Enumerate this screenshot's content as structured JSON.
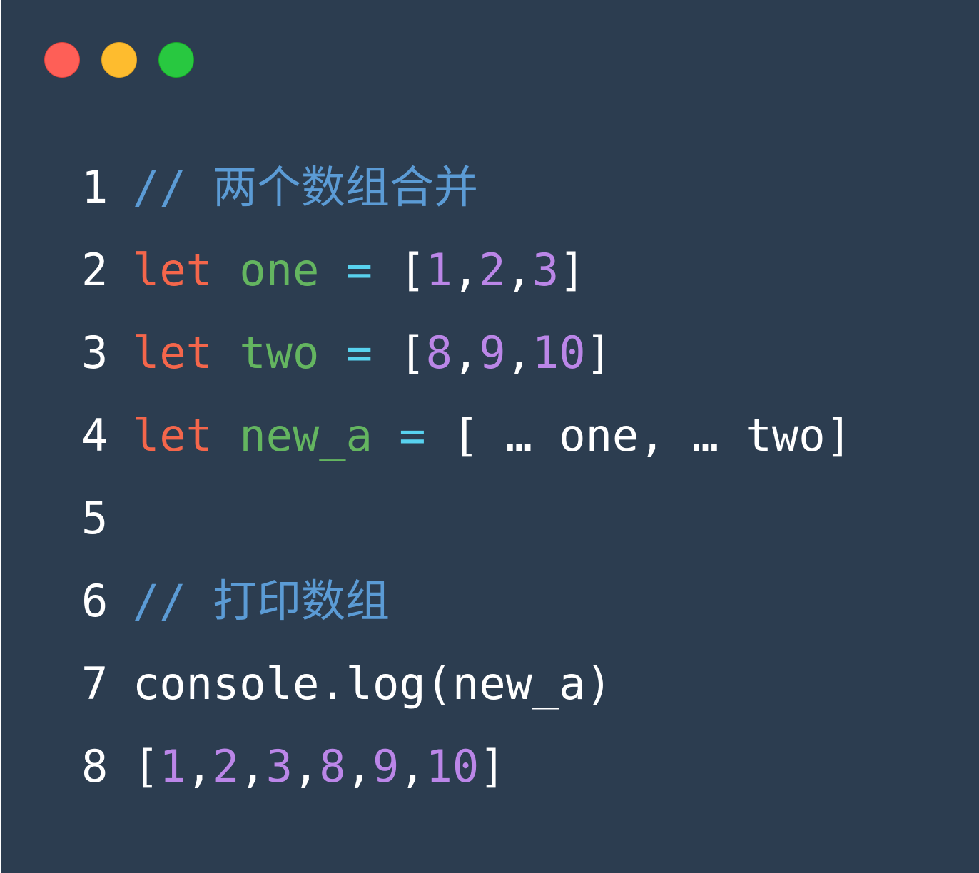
{
  "window": {
    "controls": [
      "close",
      "minimize",
      "maximize"
    ]
  },
  "colors": {
    "background": "#2c3d50",
    "keyword": "#f4664b",
    "identifier": "#64b560",
    "operator": "#58d2ef",
    "number": "#bb86e8",
    "comment": "#5b9bd5",
    "text": "#ffffff"
  },
  "code": {
    "lines": [
      {
        "num": "1",
        "tokens": [
          {
            "t": "// 两个数组合并",
            "c": "cm"
          }
        ]
      },
      {
        "num": "2",
        "tokens": [
          {
            "t": "let",
            "c": "kw"
          },
          {
            "t": " ",
            "c": "plain"
          },
          {
            "t": "one",
            "c": "id"
          },
          {
            "t": " ",
            "c": "plain"
          },
          {
            "t": "=",
            "c": "op"
          },
          {
            "t": " ",
            "c": "plain"
          },
          {
            "t": "[",
            "c": "punc"
          },
          {
            "t": "1",
            "c": "num"
          },
          {
            "t": ",",
            "c": "punc"
          },
          {
            "t": "2",
            "c": "num"
          },
          {
            "t": ",",
            "c": "punc"
          },
          {
            "t": "3",
            "c": "num"
          },
          {
            "t": "]",
            "c": "punc"
          }
        ]
      },
      {
        "num": "3",
        "tokens": [
          {
            "t": "let",
            "c": "kw"
          },
          {
            "t": " ",
            "c": "plain"
          },
          {
            "t": "two",
            "c": "id"
          },
          {
            "t": " ",
            "c": "plain"
          },
          {
            "t": "=",
            "c": "op"
          },
          {
            "t": " ",
            "c": "plain"
          },
          {
            "t": "[",
            "c": "punc"
          },
          {
            "t": "8",
            "c": "num"
          },
          {
            "t": ",",
            "c": "punc"
          },
          {
            "t": "9",
            "c": "num"
          },
          {
            "t": ",",
            "c": "punc"
          },
          {
            "t": "10",
            "c": "num"
          },
          {
            "t": "]",
            "c": "punc"
          }
        ]
      },
      {
        "num": "4",
        "tokens": [
          {
            "t": "let",
            "c": "kw"
          },
          {
            "t": " ",
            "c": "plain"
          },
          {
            "t": "new_a",
            "c": "id"
          },
          {
            "t": " ",
            "c": "plain"
          },
          {
            "t": "=",
            "c": "op"
          },
          {
            "t": " ",
            "c": "plain"
          },
          {
            "t": "[ … one, … two]",
            "c": "plain"
          }
        ]
      },
      {
        "num": "5",
        "tokens": []
      },
      {
        "num": "6",
        "tokens": [
          {
            "t": "// 打印数组",
            "c": "cm"
          }
        ]
      },
      {
        "num": "7",
        "tokens": [
          {
            "t": "console.log(new_a)",
            "c": "plain"
          }
        ]
      },
      {
        "num": "8",
        "tokens": [
          {
            "t": "[",
            "c": "punc"
          },
          {
            "t": "1",
            "c": "num"
          },
          {
            "t": ",",
            "c": "punc"
          },
          {
            "t": "2",
            "c": "num"
          },
          {
            "t": ",",
            "c": "punc"
          },
          {
            "t": "3",
            "c": "num"
          },
          {
            "t": ",",
            "c": "punc"
          },
          {
            "t": "8",
            "c": "num"
          },
          {
            "t": ",",
            "c": "punc"
          },
          {
            "t": "9",
            "c": "num"
          },
          {
            "t": ",",
            "c": "punc"
          },
          {
            "t": "10",
            "c": "num"
          },
          {
            "t": "]",
            "c": "punc"
          }
        ]
      }
    ]
  }
}
